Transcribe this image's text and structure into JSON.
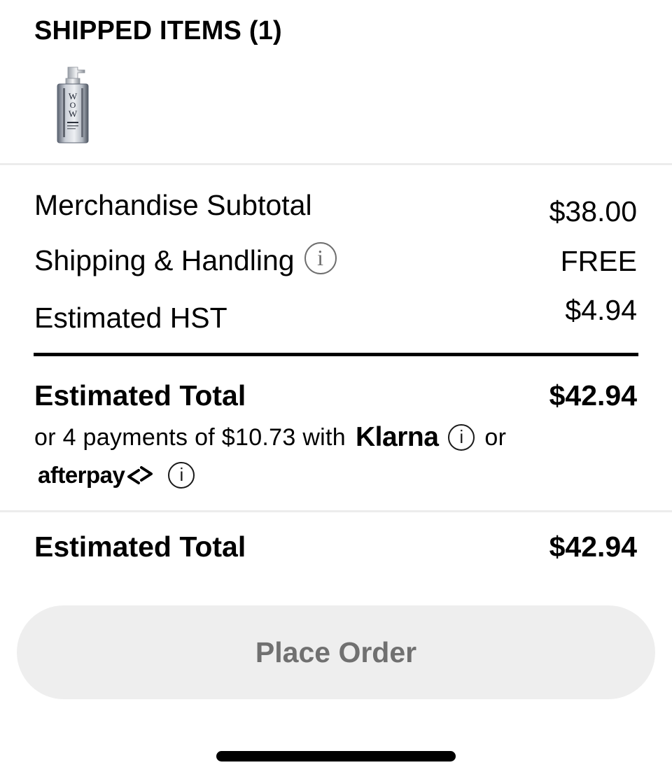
{
  "shipped": {
    "title": "SHIPPED ITEMS (1)",
    "item_icon": "product-bottle-image"
  },
  "summary": {
    "merch_label": "Merchandise Subtotal",
    "merch_value": "$38.00",
    "shipping_label": "Shipping & Handling",
    "shipping_value": "FREE",
    "tax_label": "Estimated HST",
    "tax_value": "$4.94",
    "total_label": "Estimated Total",
    "total_value": "$42.94"
  },
  "installments": {
    "text": "or 4 payments of $10.73 with",
    "klarna_logo": "Klarna",
    "or_text": "or",
    "afterpay_logo": "afterpay",
    "info_glyph": "i"
  },
  "footer": {
    "total_label": "Estimated Total",
    "total_value": "$42.94",
    "place_order_label": "Place Order"
  },
  "colors": {
    "button_bg": "#eeeeee",
    "button_text": "#707070",
    "divider": "#ececec",
    "text": "#000000"
  }
}
